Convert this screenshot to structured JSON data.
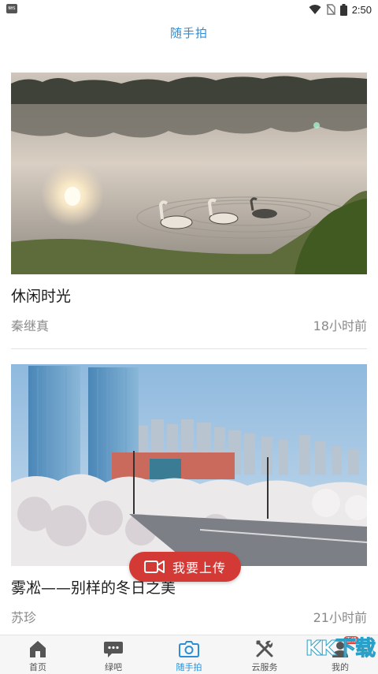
{
  "status_bar": {
    "time": "2:50"
  },
  "header": {
    "title": "随手拍"
  },
  "posts": [
    {
      "title": "休闲时光",
      "author": "秦继真",
      "time_ago": "18小时前"
    },
    {
      "title": "雾凇——别样的冬日之美",
      "author": "苏珍",
      "time_ago": "21小时前"
    }
  ],
  "upload": {
    "label": "我要上传"
  },
  "nav": {
    "items": [
      {
        "label": "首页",
        "icon": "home-icon"
      },
      {
        "label": "绿吧",
        "icon": "chat-bubble-icon"
      },
      {
        "label": "随手拍",
        "icon": "camera-icon"
      },
      {
        "label": "云服务",
        "icon": "tools-icon"
      },
      {
        "label": "我的",
        "icon": "user-icon"
      }
    ],
    "active_index": 2,
    "badge": "直播"
  },
  "colors": {
    "accent": "#2a8fd8",
    "upload_button": "#d43a35"
  }
}
